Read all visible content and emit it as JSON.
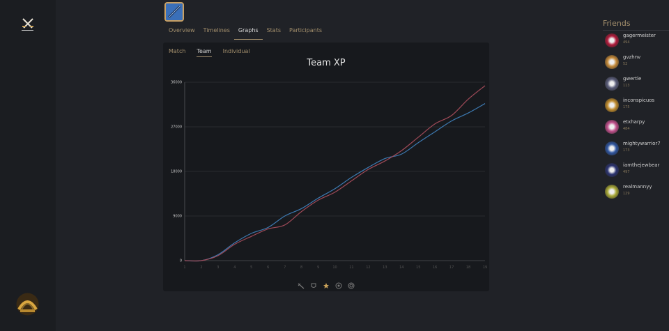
{
  "sidebar": {
    "logo_icon": "crossed-swords-icon",
    "avatar_icon": "golden-arch-avatar"
  },
  "game": {
    "icon": "champion-portrait"
  },
  "tabs": [
    "Overview",
    "Timelines",
    "Graphs",
    "Stats",
    "Participants"
  ],
  "active_tab": "Graphs",
  "subtabs": [
    "Match",
    "Team",
    "Individual"
  ],
  "active_subtab": "Team",
  "chart_icons": [
    "sword-icon",
    "shield-icon",
    "star-icon",
    "target-icon",
    "circle-icon"
  ],
  "colors": {
    "accent": "#a38f6c",
    "series_blue": "#3d7ab2",
    "series_red": "#a04a58"
  },
  "chart_data": {
    "type": "line",
    "title": "Team XP",
    "x": [
      1,
      2,
      3,
      4,
      5,
      6,
      7,
      8,
      9,
      10,
      11,
      12,
      13,
      14,
      15,
      16,
      17,
      18,
      19
    ],
    "yticks": [
      0,
      9000,
      18000,
      27000,
      36000
    ],
    "ylim": [
      0,
      36000
    ],
    "grid": true,
    "series": [
      {
        "color": "#3d7ab2",
        "values": [
          0,
          0,
          1200,
          3600,
          5500,
          6700,
          9000,
          10500,
          12600,
          14500,
          16800,
          18800,
          20600,
          21500,
          23800,
          26000,
          28200,
          29800,
          31700
        ]
      },
      {
        "color": "#a04a58",
        "values": [
          0,
          0,
          1000,
          3300,
          4900,
          6400,
          7200,
          9900,
          12200,
          13800,
          16100,
          18400,
          20100,
          22200,
          24900,
          27600,
          29300,
          32600,
          35300
        ]
      }
    ]
  },
  "friends": {
    "title": "Friends",
    "items": [
      {
        "name": "gagermeister",
        "level": "494",
        "color": "#b01c3c"
      },
      {
        "name": "gvzhnv",
        "level": "52",
        "color": "#c48a3a"
      },
      {
        "name": "gwertle",
        "level": "113",
        "color": "#5a5d7a"
      },
      {
        "name": "inconspicuos",
        "level": "175",
        "color": "#c08c2e"
      },
      {
        "name": "etxharpy",
        "level": "484",
        "color": "#c0508c"
      },
      {
        "name": "mightywarrior7",
        "level": "173",
        "color": "#3056a0"
      },
      {
        "name": "iamthejewbear",
        "level": "497",
        "color": "#2c3470"
      },
      {
        "name": "realmannyy",
        "level": "129",
        "color": "#a8a838"
      }
    ]
  }
}
